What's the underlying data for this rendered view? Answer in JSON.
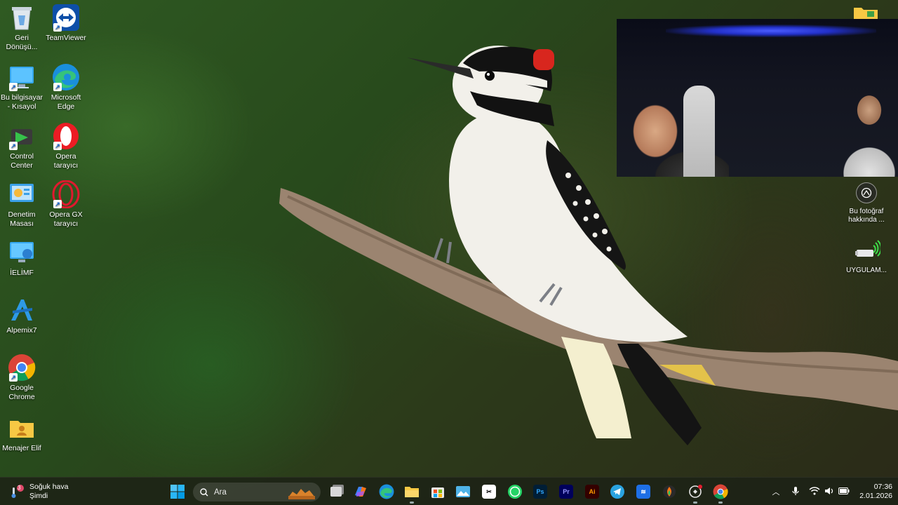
{
  "desktop_icons_left": [
    {
      "id": "recycle-bin",
      "label": "Geri\nDönüşü...",
      "icon": "recycle-bin-icon"
    },
    {
      "id": "this-pc",
      "label": "Bu bilgisayar\n- Kısayol",
      "icon": "computer-icon"
    },
    {
      "id": "control-center",
      "label": "Control\nCenter",
      "icon": "control-center-icon"
    },
    {
      "id": "control-panel",
      "label": "Denetim\nMasası",
      "icon": "control-panel-icon"
    },
    {
      "id": "ielimf",
      "label": "İELİMF",
      "icon": "network-computer-icon"
    },
    {
      "id": "alpemix",
      "label": "Alpemix7",
      "icon": "alpemix-icon"
    },
    {
      "id": "chrome",
      "label": "Google\nChrome",
      "icon": "chrome-icon"
    },
    {
      "id": "menajer-elif",
      "label": "Menajer Elif",
      "icon": "folder-user-icon"
    }
  ],
  "desktop_icons_second_col": [
    {
      "id": "teamviewer",
      "label": "TeamViewer",
      "icon": "teamviewer-icon"
    },
    {
      "id": "edge",
      "label": "Microsoft\nEdge",
      "icon": "edge-icon"
    },
    {
      "id": "opera",
      "label": "Opera\ntarayıcı",
      "icon": "opera-icon"
    },
    {
      "id": "opera-gx",
      "label": "Opera GX\ntarayıcı",
      "icon": "opera-gx-icon"
    }
  ],
  "desktop_icons_right": [
    {
      "id": "about-photo",
      "label": "Bu fotoğraf\nhakkında ...",
      "icon": "camera-info-icon"
    },
    {
      "id": "uygulama",
      "label": "UYGULAM...",
      "icon": "wireless-usb-icon"
    }
  ],
  "taskbar": {
    "weather": {
      "title": "Soğuk hava",
      "subtitle": "Şimdi",
      "badge": "3"
    },
    "search_placeholder": "Ara",
    "apps": [
      {
        "id": "task-view",
        "icon": "task-view-icon"
      },
      {
        "id": "copilot",
        "icon": "copilot-icon"
      },
      {
        "id": "edge",
        "icon": "edge-icon"
      },
      {
        "id": "file-explorer",
        "icon": "folder-icon"
      },
      {
        "id": "store",
        "icon": "store-icon"
      },
      {
        "id": "photos",
        "icon": "photos-icon"
      },
      {
        "id": "capcut",
        "icon": "capcut-icon"
      },
      {
        "id": "whatsapp",
        "icon": "whatsapp-icon"
      },
      {
        "id": "photoshop",
        "icon": "photoshop-icon",
        "text": "Ps"
      },
      {
        "id": "premiere",
        "icon": "premiere-icon",
        "text": "Pr"
      },
      {
        "id": "illustrator",
        "icon": "illustrator-icon",
        "text": "Ai"
      },
      {
        "id": "telegram",
        "icon": "telegram-icon"
      },
      {
        "id": "app-blue",
        "icon": "blue-app-icon"
      },
      {
        "id": "app-flame",
        "icon": "flame-app-icon"
      },
      {
        "id": "app-dark",
        "icon": "dark-app-icon"
      },
      {
        "id": "chrome",
        "icon": "chrome-icon"
      }
    ],
    "clock": {
      "time": "07:36",
      "date": "2.01.2026"
    }
  }
}
